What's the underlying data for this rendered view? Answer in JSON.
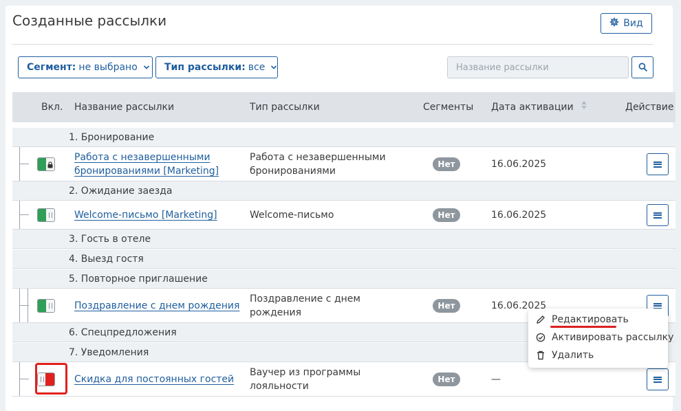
{
  "page": {
    "title": "Созданные рассылки",
    "view_button": "Вид"
  },
  "filters": {
    "segment_label": "Сегмент:",
    "segment_value": "не выбрано",
    "type_label": "Тип рассылки:",
    "type_value": "все",
    "search_placeholder": "Название рассылки"
  },
  "table": {
    "columns": [
      "Вкл.",
      "Название рассылки",
      "Тип рассылки",
      "Сегменты",
      "Дата активации",
      "Действие"
    ],
    "groups": [
      "1. Бронирование",
      "2. Ожидание заезда",
      "3. Гость в отеле",
      "4. Выезд гостя",
      "5. Повторное приглашение",
      "6. Спецпредложения",
      "7. Уведомления"
    ],
    "rows": [
      {
        "name_line1": "Работа с незавершенными",
        "name_line2": "бронированиями [Marketing]",
        "type_line1": "Работа с незавершенными",
        "type_line2": "бронированиями",
        "segments": "Нет",
        "date": "16.06.2025",
        "enabled": true,
        "locked": true
      },
      {
        "name_line1": "Welcome-письмо  [Marketing]",
        "type_line1": "Welcome-письмо",
        "segments": "Нет",
        "date": "16.06.2025",
        "enabled": true,
        "locked": false
      },
      {
        "name_line1": "Поздравление с днем рождения",
        "type_line1": "Поздравление с днем",
        "type_line2": "рождения",
        "segments": "Нет",
        "date": "16.06.2025",
        "enabled": true,
        "locked": false
      },
      {
        "name_line1": "Скидка для постоянных гостей",
        "type_line1": "Ваучер из программы",
        "type_line2": "лояльности",
        "segments": "Нет",
        "date": "—",
        "enabled": false,
        "locked": false
      }
    ]
  },
  "action_menu": {
    "edit": "Редактировать",
    "activate": "Активировать рассылку",
    "delete": "Удалить"
  },
  "colors": {
    "accent": "#1f5e9e",
    "toggle_on": "#2f9e57",
    "toggle_off": "#e0201d",
    "badge": "#8e969e",
    "highlight": "#e0201d"
  }
}
